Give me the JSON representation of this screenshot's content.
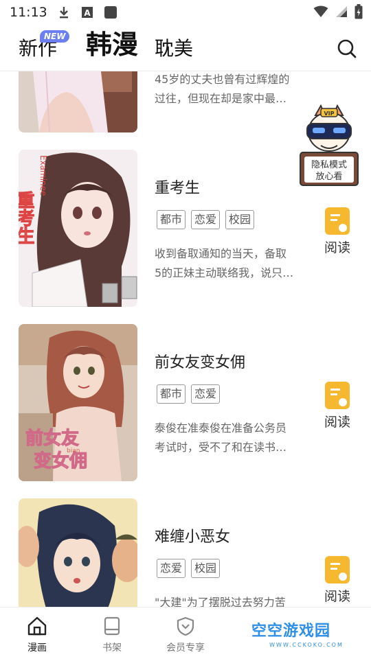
{
  "status_bar": {
    "time": "11:13"
  },
  "header": {
    "tabs": [
      {
        "label": "新作",
        "badge": "NEW"
      },
      {
        "label": "韩漫"
      },
      {
        "label": "耽美"
      }
    ]
  },
  "items": [
    {
      "title": "",
      "tags": [],
      "desc_line1": "45岁的丈夫也曾有过辉煌的",
      "desc_line2": "过往，但现在却是家中最…",
      "read_label": "阅读"
    },
    {
      "title": "重考生",
      "tags": [
        "都市",
        "恋爱",
        "校园"
      ],
      "desc_line1": "收到备取通知的当天，备取",
      "desc_line2": "5的正妹主动联络我，说只…",
      "read_label": "阅读",
      "cover_text": "重考生",
      "cover_sub": "Examinee"
    },
    {
      "title": "前女友变女佣",
      "tags": [
        "都市",
        "恋爱"
      ],
      "desc_line1": "泰俊在准泰俊在准备公务员",
      "desc_line2": "考试时，受不了和在读书…",
      "read_label": "阅读",
      "cover_text1": "前女友",
      "cover_text2": "变女佣",
      "cover_sub": "bian"
    },
    {
      "title": "难缠小恶女",
      "tags": [
        "恋爱",
        "校园"
      ],
      "desc_line1": "\"大建\"为了摆脱过去努力苦",
      "desc_line2": "",
      "read_label": "阅读"
    }
  ],
  "vip_float": {
    "badge": "VIP",
    "caption_line1": "隐私模式",
    "caption_line2": "放心看"
  },
  "bottom_nav": [
    {
      "label": "漫画",
      "active": true
    },
    {
      "label": "书架"
    },
    {
      "label": "会员专享"
    }
  ],
  "watermark": {
    "text": "空空游戏园",
    "sub": "WWW.CCKOKO.COM"
  },
  "colors": {
    "accent": "#f5b82e",
    "badge": "#6b7ff0",
    "watermark": "#2d8fe8"
  }
}
